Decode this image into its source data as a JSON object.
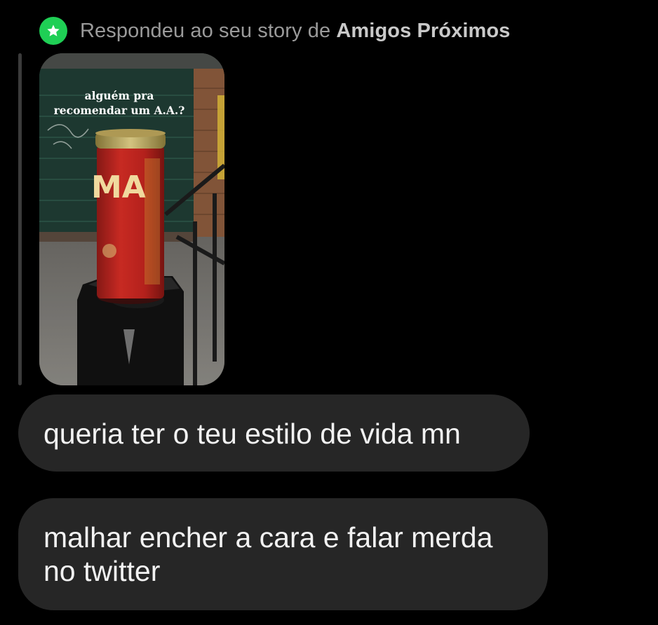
{
  "reply_header": {
    "prefix": "Respondeu ao seu story de",
    "audience": "Amigos Próximos",
    "badge_icon": "star-icon",
    "badge_color": "#1fcf55"
  },
  "story": {
    "caption_lines": [
      "alguém pra",
      "recomendar um A.A.?"
    ],
    "can_label": "MA"
  },
  "messages": [
    {
      "lines": [
        "queria ter o teu estilo de vida mn"
      ]
    },
    {
      "lines": [
        "malhar encher a cara e falar merda",
        "no twitter"
      ]
    }
  ],
  "colors": {
    "background": "#000000",
    "bubble": "#262626",
    "message_text": "#f2f2f2",
    "header_text": "#9a9a9a"
  }
}
